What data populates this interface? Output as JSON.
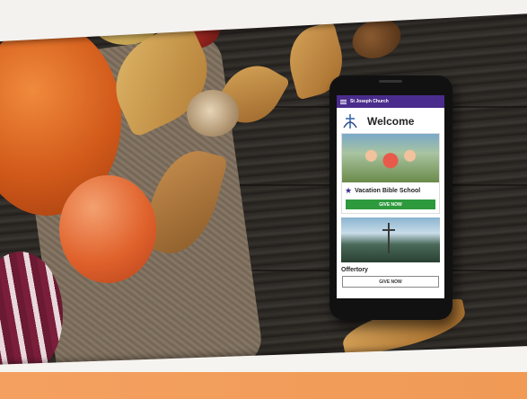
{
  "app": {
    "title": "St Joseph Church",
    "menu_icon": "hamburger-menu-icon",
    "accent_color": "#4a2c8c"
  },
  "home": {
    "welcome": "Welcome",
    "logo_icon": "church-logo-icon"
  },
  "cards": [
    {
      "title": "Vacation Bible School",
      "title_icon": "star-icon",
      "button_label": "GIVE NOW",
      "button_color": "#2e9a3e",
      "image": "children-playing-photo"
    }
  ],
  "offertory": {
    "image": "cross-mountain-photo",
    "title": "Offertory",
    "button_label": "GIVE NOW"
  }
}
